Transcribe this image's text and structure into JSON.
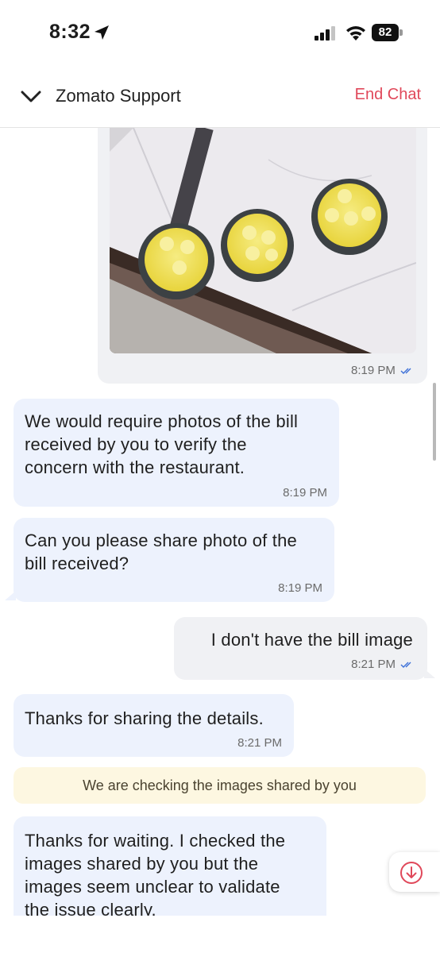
{
  "status_bar": {
    "time": "8:32",
    "battery": "82"
  },
  "header": {
    "title": "Zomato Support",
    "end_chat": "End Chat"
  },
  "messages": [
    {
      "type": "outgoing-image",
      "time": "8:19 PM",
      "read": true
    },
    {
      "type": "incoming",
      "text_lines": [
        "We would require photos of the bill",
        "received by you to verify the",
        "concern with the restaurant."
      ],
      "time": "8:19 PM"
    },
    {
      "type": "incoming",
      "text_lines": [
        "Can you please share photo of the",
        "bill received?"
      ],
      "time": "8:19 PM"
    },
    {
      "type": "outgoing",
      "text": "I don't have the bill image",
      "time": "8:21 PM",
      "read": true
    },
    {
      "type": "incoming",
      "text_lines": [
        "Thanks for sharing the details."
      ],
      "time": "8:21 PM"
    },
    {
      "type": "system",
      "text": "We are checking the images shared by you"
    },
    {
      "type": "incoming",
      "text_lines": [
        "Thanks for waiting. I checked the",
        "images shared by you but the",
        "images seem unclear to validate",
        "the issue clearly."
      ]
    }
  ],
  "colors": {
    "accent_red": "#e0485a",
    "incoming_bg": "#edf2fd",
    "outgoing_bg": "#f0f1f4",
    "notice_bg": "#fdf7e1",
    "tick_blue": "#3b6fd8"
  },
  "icons": [
    "location-arrow-icon",
    "signal-icon",
    "wifi-icon",
    "battery-icon",
    "chevron-down-icon",
    "double-check-icon",
    "arrow-down-circle-icon"
  ]
}
